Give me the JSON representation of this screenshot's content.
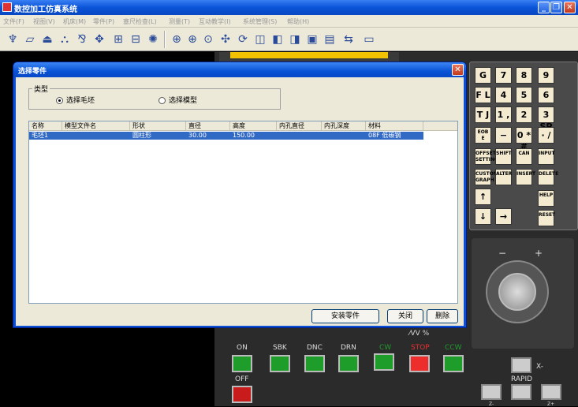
{
  "app": {
    "title": "数控加工仿真系统"
  },
  "menu": [
    "文件(F)",
    "视图(V)",
    "机床(M)",
    "零件(P)",
    "塞尺检查(L)",
    "测量(T)",
    "互动教学(I)",
    "系统管理(S)",
    "帮助(H)"
  ],
  "toolbar": {
    "icons": [
      "machine-select-icon",
      "blank-define-icon",
      "fixture-icon",
      "place-part-icon",
      "tool-select-icon",
      "coolant-icon",
      "measure-icon",
      "probe-icon",
      "dim-icon",
      "zoom-in-icon",
      "zoom-all-icon",
      "zoom-window-icon",
      "pan-icon",
      "rotate-icon",
      "view-front-icon",
      "view-top-icon",
      "view-left-icon",
      "view-right-icon",
      "control-panel-icon",
      "toggle-display-icon",
      "keyboard-icon"
    ],
    "glyphs": [
      "♆",
      "▱",
      "⏏",
      "⛬",
      "⅋",
      "✥",
      "⊞",
      "⊟",
      "✺",
      "⊕",
      "⊕",
      "⊙",
      "✣",
      "⟳",
      "◫",
      "◧",
      "◨",
      "▣",
      "▤",
      "⇆",
      "▭"
    ]
  },
  "keypad": {
    "rows": [
      [
        "G R",
        "7 A",
        "8 ↑B",
        "9 D"
      ],
      [
        "F L",
        "4 ← I",
        "5 ⁿ/ J",
        "6 → SP"
      ],
      [
        "T J",
        "1 ,",
        "2 ↓ #",
        "3 ="
      ],
      [
        "EOB E",
        "− +",
        "0 *",
        "· /"
      ],
      [
        "OFFSET SETTING",
        "SHIFT",
        "CAN",
        "INPUT"
      ],
      [
        "CUSTOM GRAPH",
        "ALTER",
        "INSERT",
        "DELETE"
      ],
      [
        "↑",
        "",
        "",
        "HELP"
      ],
      [
        "↓",
        "→",
        "",
        "RESET"
      ]
    ]
  },
  "control_panel": {
    "on_label": "ON",
    "off_label": "OFF",
    "buttons": [
      {
        "label": "SBK",
        "color": "#1f9d2b",
        "label_color": "#dddddd"
      },
      {
        "label": "DNC",
        "color": "#1f9d2b",
        "label_color": "#dddddd"
      },
      {
        "label": "DRN",
        "color": "#1f9d2b",
        "label_color": "#dddddd"
      },
      {
        "label": "CW",
        "color": "#1f9d2b",
        "label_color": "#1f9d2b"
      },
      {
        "label": "STOP",
        "color": "#ee2d2d",
        "label_color": "#ee2d2d"
      },
      {
        "label": "CCW",
        "color": "#1f9d2b",
        "label_color": "#1f9d2b"
      }
    ],
    "spindle_caption": "⁄ᐯᐯ %",
    "x_minus": "X-",
    "rapid": "RAPID",
    "z_minus": "Z-",
    "z_plus": "Z+",
    "knob_minus": "−",
    "knob_plus": "+"
  },
  "dialog": {
    "title": "选择零件",
    "group_label": "类型",
    "radio_blank": "选择毛坯",
    "radio_model": "选择模型",
    "selected": "radio_blank",
    "columns": [
      "名称",
      "模型文件名",
      "形状",
      "直径",
      "高度",
      "内孔直径",
      "内孔深度",
      "材料"
    ],
    "rows": [
      [
        "毛坯1",
        "",
        "圆柱形",
        "30.00",
        "150.00",
        "",
        "",
        "08F 低碳钢"
      ]
    ],
    "buttons": {
      "install": "安装零件",
      "close": "关闭",
      "delete": "删除"
    }
  },
  "colors": {
    "title_blue": "#0a54d8",
    "selection": "#316ac5",
    "dialog_bg": "#ece9d8"
  }
}
